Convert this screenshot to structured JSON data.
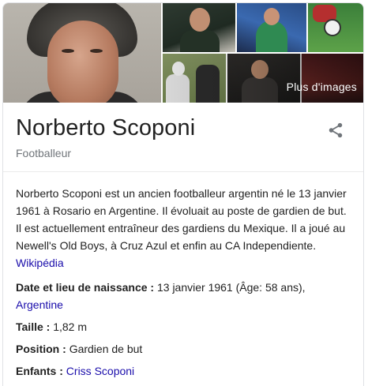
{
  "images": {
    "more_images_label": "Plus d'images"
  },
  "header": {
    "title": "Norberto Scoponi",
    "subtitle": "Footballeur"
  },
  "description": {
    "text": "Norberto Scoponi est un ancien footballeur argentin né le 13 janvier 1961 à Rosario en Argentine. Il évoluait au poste de gardien de but. Il est actuellement entraîneur des gardiens du Mexique. Il a joué au Newell's Old Boys, à Cruz Azul et enfin au CA Independiente.",
    "source_link": "Wikipédia"
  },
  "facts": {
    "birth": {
      "label": "Date et lieu de naissance",
      "value": "13 janvier 1961 (Âge: 58 ans),",
      "link": "Argentine"
    },
    "height": {
      "label": "Taille",
      "value": "1,82 m"
    },
    "position": {
      "label": "Position",
      "value": "Gardien de but"
    },
    "children": {
      "label": "Enfants",
      "link": "Criss Scoponi"
    }
  },
  "colors": {
    "link": "#1a0dab",
    "secondary_text": "#70757a",
    "border": "#dfe1e5"
  },
  "icons": {
    "share": "share-icon"
  }
}
